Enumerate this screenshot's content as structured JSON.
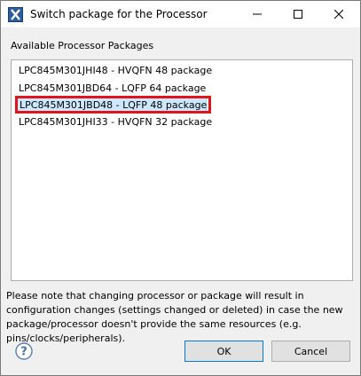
{
  "window": {
    "title": "Switch package for the Processor"
  },
  "group": {
    "label": "Available Processor Packages"
  },
  "packages": [
    {
      "label": "LPC845M301JHI48 - HVQFN 48 package"
    },
    {
      "label": "LPC845M301JBD64 - LQFP 64 package"
    },
    {
      "label": "LPC845M301JBD48 - LQFP 48 package",
      "selected": true
    },
    {
      "label": "LPC845M301JHI33 - HVQFN 32 package"
    }
  ],
  "note": "Please note that changing processor or package will result in configuration changes (settings changed or deleted) in case the new package/processor doesn't provide the same resources (e.g. pins/clocks/peripherals).",
  "buttons": {
    "ok": "OK",
    "cancel": "Cancel"
  },
  "icons": {
    "app": "x-app-icon",
    "minimize": "minimize-icon",
    "maximize": "maximize-icon",
    "close": "close-icon",
    "help": "help-icon"
  },
  "colors": {
    "selection_bg": "#cce8ff",
    "selection_border": "#99d1ff",
    "annotation_red": "#e0141c",
    "default_button_border": "#0078d7"
  }
}
